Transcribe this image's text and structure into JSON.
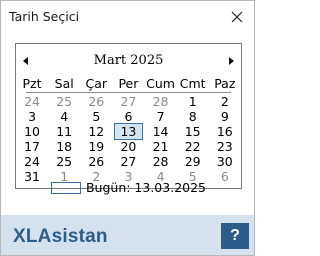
{
  "window": {
    "title": "Tarih Seçici"
  },
  "calendar": {
    "month_label": "Mart 2025",
    "weekdays": [
      "Pzt",
      "Sal",
      "Çar",
      "Per",
      "Cum",
      "Cmt",
      "Paz"
    ],
    "weeks": [
      [
        {
          "d": "24",
          "m": true
        },
        {
          "d": "25",
          "m": true
        },
        {
          "d": "26",
          "m": true
        },
        {
          "d": "27",
          "m": true
        },
        {
          "d": "28",
          "m": true
        },
        {
          "d": "1"
        },
        {
          "d": "2"
        }
      ],
      [
        {
          "d": "3"
        },
        {
          "d": "4"
        },
        {
          "d": "5"
        },
        {
          "d": "6"
        },
        {
          "d": "7"
        },
        {
          "d": "8"
        },
        {
          "d": "9"
        }
      ],
      [
        {
          "d": "10"
        },
        {
          "d": "11"
        },
        {
          "d": "12"
        },
        {
          "d": "13",
          "today": true
        },
        {
          "d": "14"
        },
        {
          "d": "15"
        },
        {
          "d": "16"
        }
      ],
      [
        {
          "d": "17"
        },
        {
          "d": "18"
        },
        {
          "d": "19"
        },
        {
          "d": "20"
        },
        {
          "d": "21"
        },
        {
          "d": "22"
        },
        {
          "d": "23"
        }
      ],
      [
        {
          "d": "24"
        },
        {
          "d": "25"
        },
        {
          "d": "26"
        },
        {
          "d": "27"
        },
        {
          "d": "28"
        },
        {
          "d": "29"
        },
        {
          "d": "30"
        }
      ],
      [
        {
          "d": "31"
        },
        {
          "d": "1",
          "m": true
        },
        {
          "d": "2",
          "m": true
        },
        {
          "d": "3",
          "m": true
        },
        {
          "d": "4",
          "m": true
        },
        {
          "d": "5",
          "m": true
        },
        {
          "d": "6",
          "m": true
        }
      ]
    ],
    "today_label": "Bugün: 13.03.2025"
  },
  "footer": {
    "brand": "XLAsistan",
    "help_label": "?"
  },
  "icons": {
    "close": "close-icon",
    "prev": "arrow-left-icon",
    "next": "arrow-right-icon"
  },
  "colors": {
    "accent": "#2c5d8a",
    "footer_bg": "#d6e1ee",
    "today_bg": "#d6e4f2",
    "muted": "#8c8c8c"
  }
}
